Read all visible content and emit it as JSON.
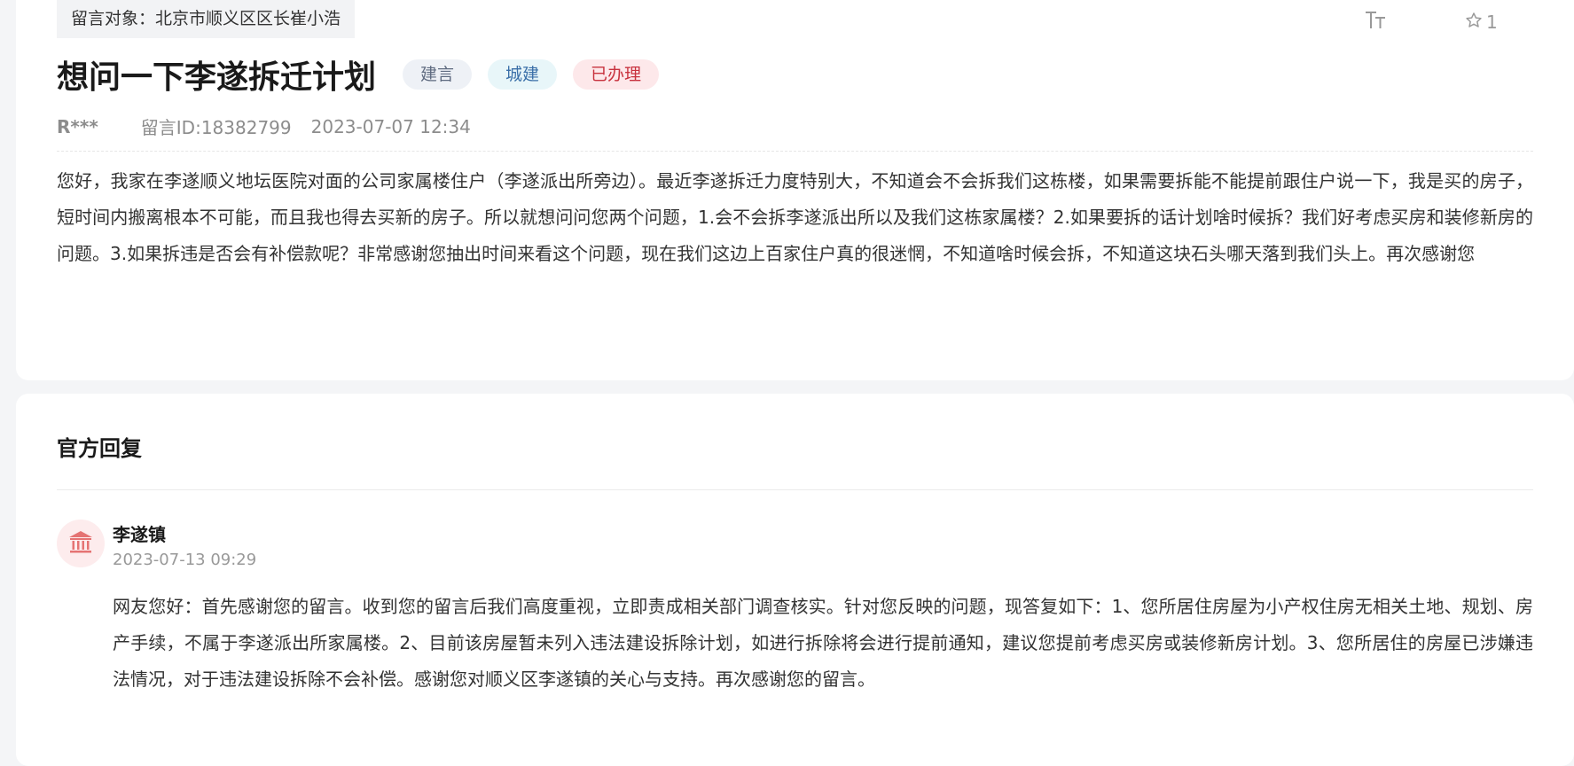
{
  "message": {
    "target_label": "留言对象：北京市顺义区区长崔小浩",
    "toolbar": {
      "font_size_icon": "font-size-icon",
      "star_icon": "star-icon",
      "favorite_count": "1"
    },
    "title": "想问一下李遂拆迁计划",
    "tags": [
      {
        "label": "建言",
        "bg": "#eef1f6",
        "color": "#5f6b80"
      },
      {
        "label": "城建",
        "bg": "#e8f6f9",
        "color": "#3a6fa8"
      },
      {
        "label": "已办理",
        "bg": "#fde8ea",
        "color": "#c8323e"
      }
    ],
    "author": "R***",
    "message_id": "留言ID:18382799",
    "date": "2023-07-07 12:34",
    "body": "您好，我家在李遂顺义地坛医院对面的公司家属楼住户（李遂派出所旁边）。最近李遂拆迁力度特别大，不知道会不会拆我们这栋楼，如果需要拆能不能提前跟住户说一下，我是买的房子，短时间内搬离根本不可能，而且我也得去买新的房子。所以就想问问您两个问题，1.会不会拆李遂派出所以及我们这栋家属楼？2.如果要拆的话计划啥时候拆？我们好考虑买房和装修新房的问题。3.如果拆违是否会有补偿款呢？非常感谢您抽出时间来看这个问题，现在我们这边上百家住户真的很迷惘，不知道啥时候会拆，不知道这块石头哪天落到我们头上。再次感谢您"
  },
  "reply": {
    "heading": "官方回复",
    "avatar_icon": "government-building-icon",
    "responder": "李遂镇",
    "time": "2023-07-13 09:29",
    "body": "网友您好：首先感谢您的留言。收到您的留言后我们高度重视，立即责成相关部门调查核实。针对您反映的问题，现答复如下：1、您所居住房屋为小产权住房无相关土地、规划、房产手续，不属于李遂派出所家属楼。2、目前该房屋暂未列入违法建设拆除计划，如进行拆除将会进行提前通知，建议您提前考虑买房或装修新房计划。3、您所居住的房屋已涉嫌违法情况，对于违法建设拆除不会补偿。感谢您对顺义区李遂镇的关心与支持。再次感谢您的留言。"
  },
  "colors": {
    "icon_gray": "#999999",
    "avatar_red": "#e57373"
  }
}
